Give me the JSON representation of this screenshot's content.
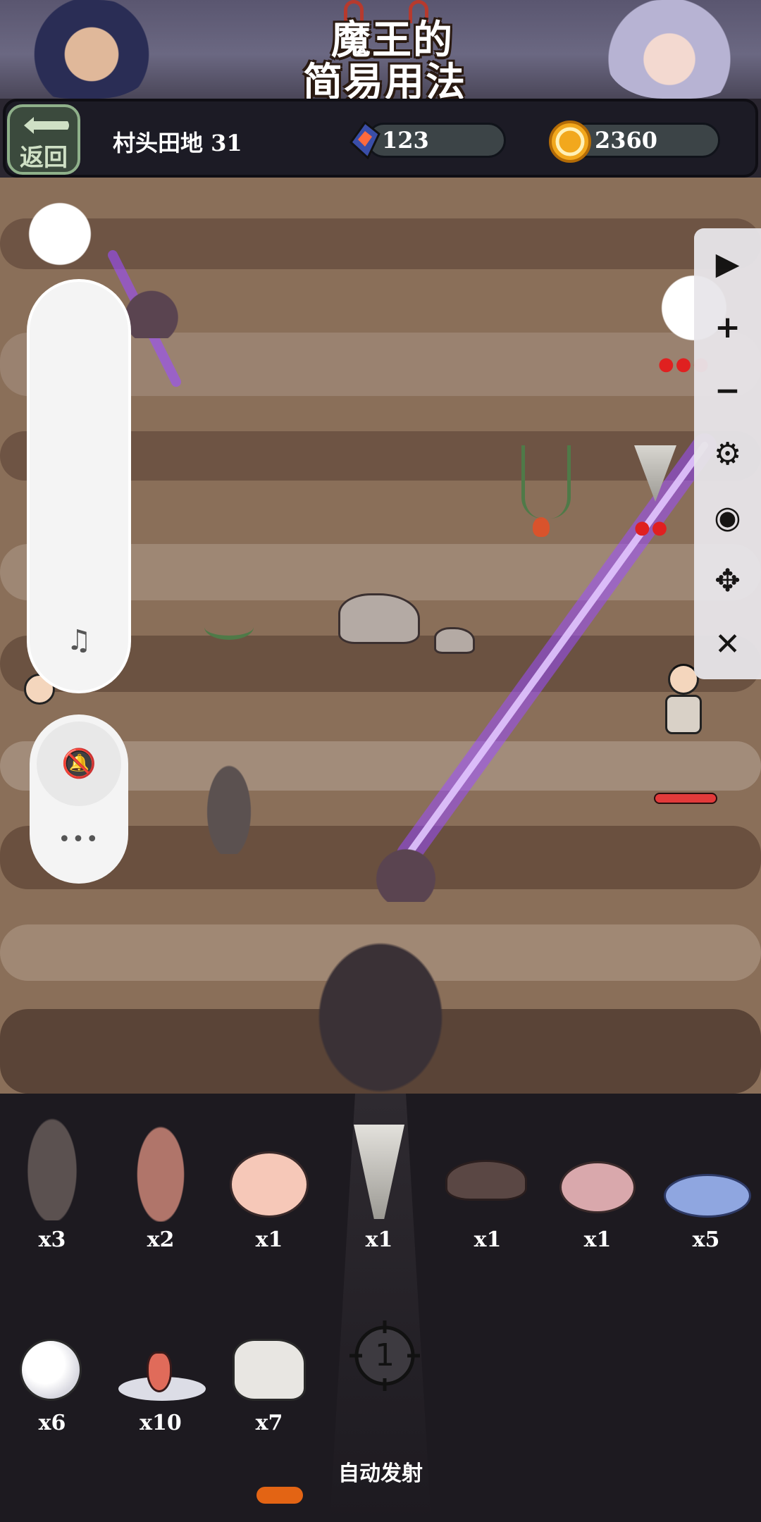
{
  "game": {
    "title_line1": "魔王的",
    "title_line2": "简易用法"
  },
  "topbar": {
    "back_label": "返回",
    "level_label": "村头田地  31",
    "gem_value": "123",
    "coin_value": "2360"
  },
  "side_controls": [
    {
      "name": "play-icon",
      "glyph": "▶"
    },
    {
      "name": "plus-icon",
      "glyph": "+"
    },
    {
      "name": "minus-icon",
      "glyph": "−"
    },
    {
      "name": "gear-icon",
      "glyph": "⚙"
    },
    {
      "name": "eye-off-icon",
      "glyph": "◉"
    },
    {
      "name": "move-icon",
      "glyph": "✥"
    },
    {
      "name": "close-icon",
      "glyph": "✕"
    }
  ],
  "floating_panel": {
    "music_off_icon": "♫",
    "bell_off_icon": "🔕",
    "more_icon": "•••"
  },
  "units": [
    {
      "name": "helmet-creature",
      "count": "x3"
    },
    {
      "name": "spiked-helmet-creature",
      "count": "x2"
    },
    {
      "name": "pig-snout",
      "count": "x1"
    },
    {
      "name": "drill-bit",
      "count": "x1"
    },
    {
      "name": "mushroom-lizard",
      "count": "x1"
    },
    {
      "name": "pink-axolotl",
      "count": "x1"
    },
    {
      "name": "blue-slime",
      "count": "x5"
    },
    {
      "name": "eyeball",
      "count": "x6"
    },
    {
      "name": "tongue-puddle",
      "count": "x10"
    },
    {
      "name": "angry-stone",
      "count": "x7"
    }
  ],
  "target_number": "1",
  "auto_fire_label": "自动发射",
  "colors": {
    "accent_orange": "#e36414",
    "beam_purple": "#9b4dff",
    "hp_red": "#e23a3a"
  }
}
